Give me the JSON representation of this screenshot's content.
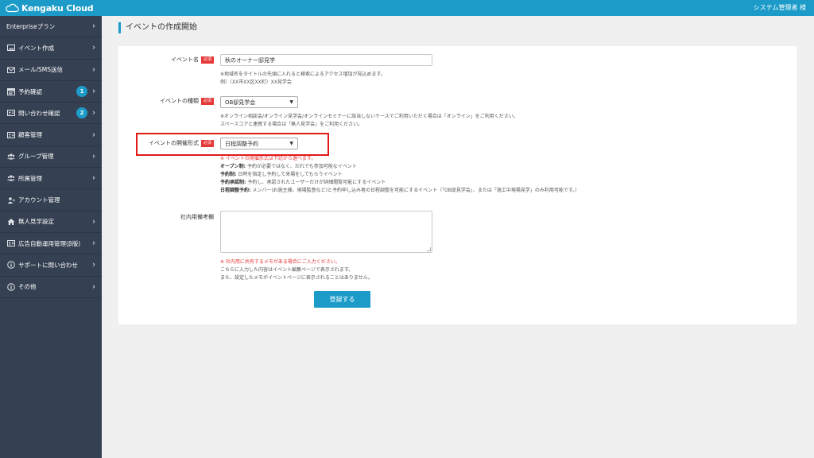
{
  "header": {
    "logo_text": "Kengaku Cloud",
    "user_name": "システム管理者 様"
  },
  "sidebar": {
    "items": [
      {
        "label": "Enterpriseプラン",
        "icon": "none"
      },
      {
        "label": "イベント作成",
        "icon": "image-icon"
      },
      {
        "label": "メール/SMS送信",
        "icon": "mail-icon"
      },
      {
        "label": "予約確認",
        "icon": "calendar-icon",
        "badge": "1"
      },
      {
        "label": "問い合わせ確認",
        "icon": "id-card-icon",
        "badge": "2"
      },
      {
        "label": "顧客管理",
        "icon": "id-card-icon"
      },
      {
        "label": "グループ管理",
        "icon": "users-icon"
      },
      {
        "label": "所属管理",
        "icon": "users-icon"
      },
      {
        "label": "アカウント管理",
        "icon": "user-plus-icon"
      },
      {
        "label": "無人見学設定",
        "icon": "home-icon"
      },
      {
        "label": "広告自動運用管理(β版)",
        "icon": "id-card-icon"
      },
      {
        "label": "サポートに問い合わせ",
        "icon": "info-icon"
      },
      {
        "label": "その他",
        "icon": "info-icon"
      }
    ]
  },
  "page": {
    "title": "イベントの作成開始"
  },
  "form": {
    "required_badge": "必須",
    "event_name": {
      "label": "イベント名",
      "value": "秋のオーナー邸見学",
      "help1": "※地域名をタイトルの先頭に入れると検索によるアクセス増加が見込めます。",
      "help2": "例）〈XX市XX区XX町〉XX見学会"
    },
    "event_type": {
      "label": "イベントの種類",
      "value": "OB邸見学会",
      "help1": "※オンライン相談会/オンライン見学会/オンラインセミナーに該当しないケースでご利用いただく場合は「オンライン」をご利用ください。",
      "help2": "スペースコアと連携する場合は「無人見学会」をご利用ください。"
    },
    "event_format": {
      "label": "イベントの開催形式",
      "value": "日程調整予約",
      "intro": "※ イベントの開催形式は下記から選べます。",
      "lines": [
        {
          "term": "オープン制:",
          "desc": "予約が必要ではなく、だれでも参加可能なイベント"
        },
        {
          "term": "予約制:",
          "desc": "日時を指定し予約して来場をしてもらうイベント"
        },
        {
          "term": "予約承認制:",
          "desc": "予約し、承認されたユーザーだけが詳細閲覧可能にするイベント"
        },
        {
          "term": "日程調整予約:",
          "desc": "メンバー(お施主様、現場監督など)と予約申し込み者の日程調整を可能にするイベント（「OB邸見学会」、または「施工中現場見学」のみ利用可能です。）"
        }
      ]
    },
    "memo": {
      "label": "社内用備考欄",
      "value": "",
      "help1": "※ 社内用に共有するメモがある場合にご入力ください。",
      "help2": "こちらに入力した内容はイベント編集ページで表示されます。",
      "help3": "また、設定したメモがイベントページに表示されることはありません。"
    },
    "submit_label": "登録する"
  },
  "colors": {
    "accent": "#1c9bc9",
    "sidebar_bg": "#354052",
    "required": "#e63737",
    "highlight": "#e01919"
  }
}
